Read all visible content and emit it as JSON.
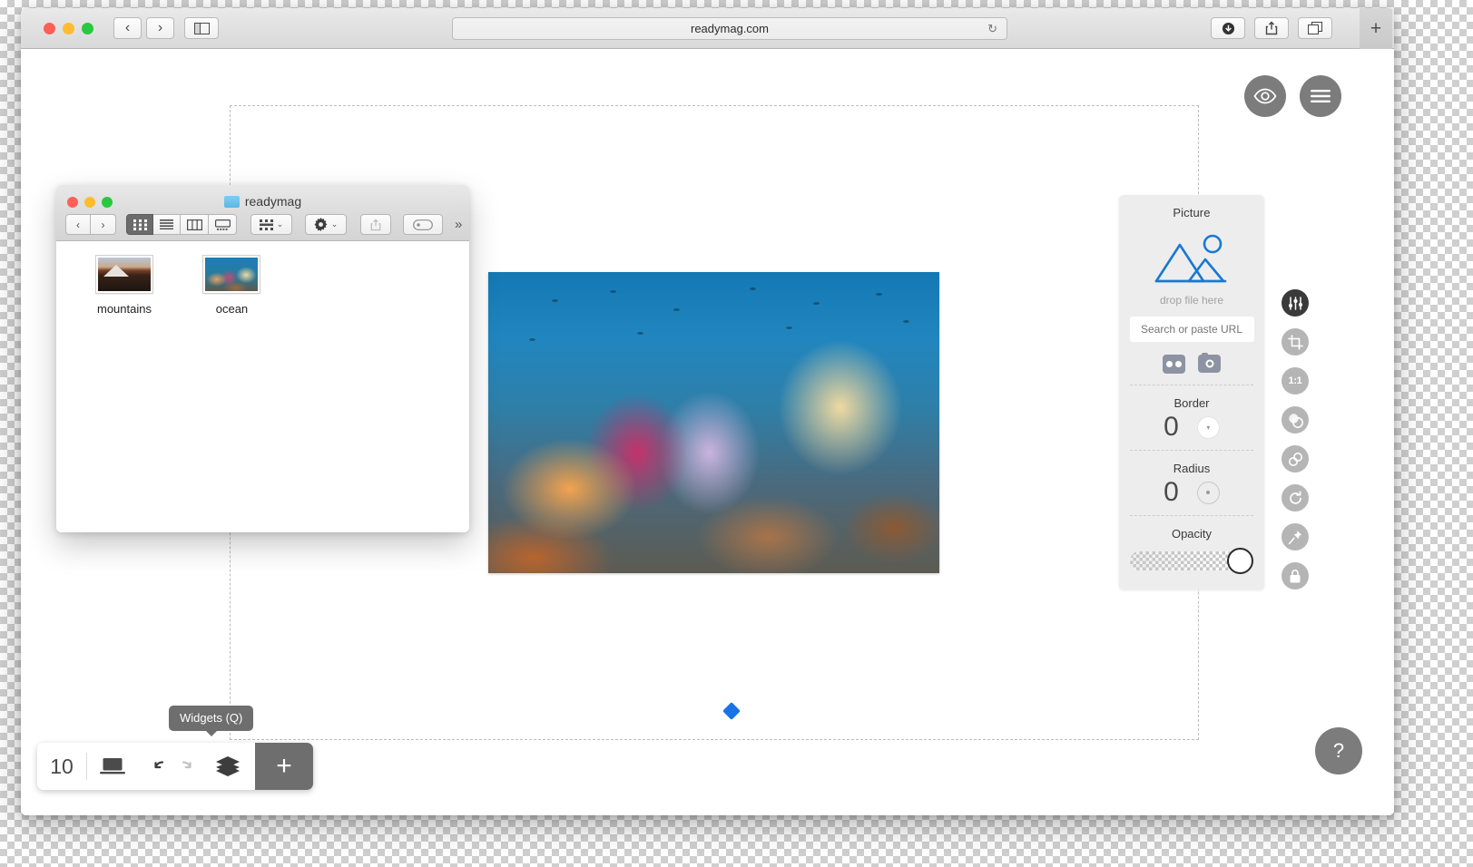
{
  "browser": {
    "url": "readymag.com",
    "traffic_lights": [
      "close",
      "minimize",
      "zoom"
    ],
    "nav": {
      "back": "‹",
      "forward": "›"
    },
    "sidebar_icon": "sidebar-icon",
    "reload_icon": "↻",
    "download_icon": "download-icon",
    "share_icon": "share-icon",
    "tabs_icon": "tab-overview-icon",
    "new_tab": "+"
  },
  "canvas": {
    "preview_icon": "eye-icon",
    "menu_icon": "hamburger-menu-icon",
    "help_label": "?"
  },
  "finder": {
    "window_title": "readymag",
    "toolbar": {
      "back": "‹",
      "forward": "›",
      "view_icon": "icon-view",
      "view_list": "list-view",
      "view_columns": "column-view",
      "view_gallery": "gallery-view",
      "group_icon": "arrange-by-icon",
      "action_icon": "gear-icon",
      "share_icon": "share-icon",
      "tag_icon": "tag-icon",
      "overflow": "»",
      "chevron": "⌄"
    },
    "files": [
      {
        "name": "mountains",
        "thumb": "thumb-mountains"
      },
      {
        "name": "ocean",
        "thumb": "thumb-ocean"
      }
    ]
  },
  "picture_panel": {
    "title": "Picture",
    "drop_hint": "drop file here",
    "url_placeholder": "Search or paste URL",
    "sources": [
      {
        "name": "flickr-icon"
      },
      {
        "name": "camera-icon"
      }
    ],
    "fields": [
      {
        "label": "Border",
        "value": "0",
        "swatch": "white-swatch"
      },
      {
        "label": "Radius",
        "value": "0",
        "swatch": "ring-swatch"
      }
    ],
    "opacity": {
      "label": "Opacity",
      "value": "100"
    }
  },
  "tool_rail": [
    {
      "name": "adjustments-icon",
      "label": "",
      "active": true
    },
    {
      "name": "crop-icon",
      "label": "",
      "active": false
    },
    {
      "name": "aspect-ratio-icon",
      "label": "1:1",
      "active": false
    },
    {
      "name": "mask-icon",
      "label": "",
      "active": false
    },
    {
      "name": "link-icon",
      "label": "",
      "active": false
    },
    {
      "name": "rotate-icon",
      "label": "",
      "active": false
    },
    {
      "name": "pin-icon",
      "label": "",
      "active": false
    },
    {
      "name": "lock-icon",
      "label": "",
      "active": false
    }
  ],
  "bottom_bar": {
    "page_count": "10",
    "device_icon": "laptop-icon",
    "undo_icon": "undo-icon",
    "redo_icon": "redo-icon",
    "widgets_icon": "layers-icon",
    "add_label": "+",
    "tooltip": "Widgets (Q)"
  }
}
